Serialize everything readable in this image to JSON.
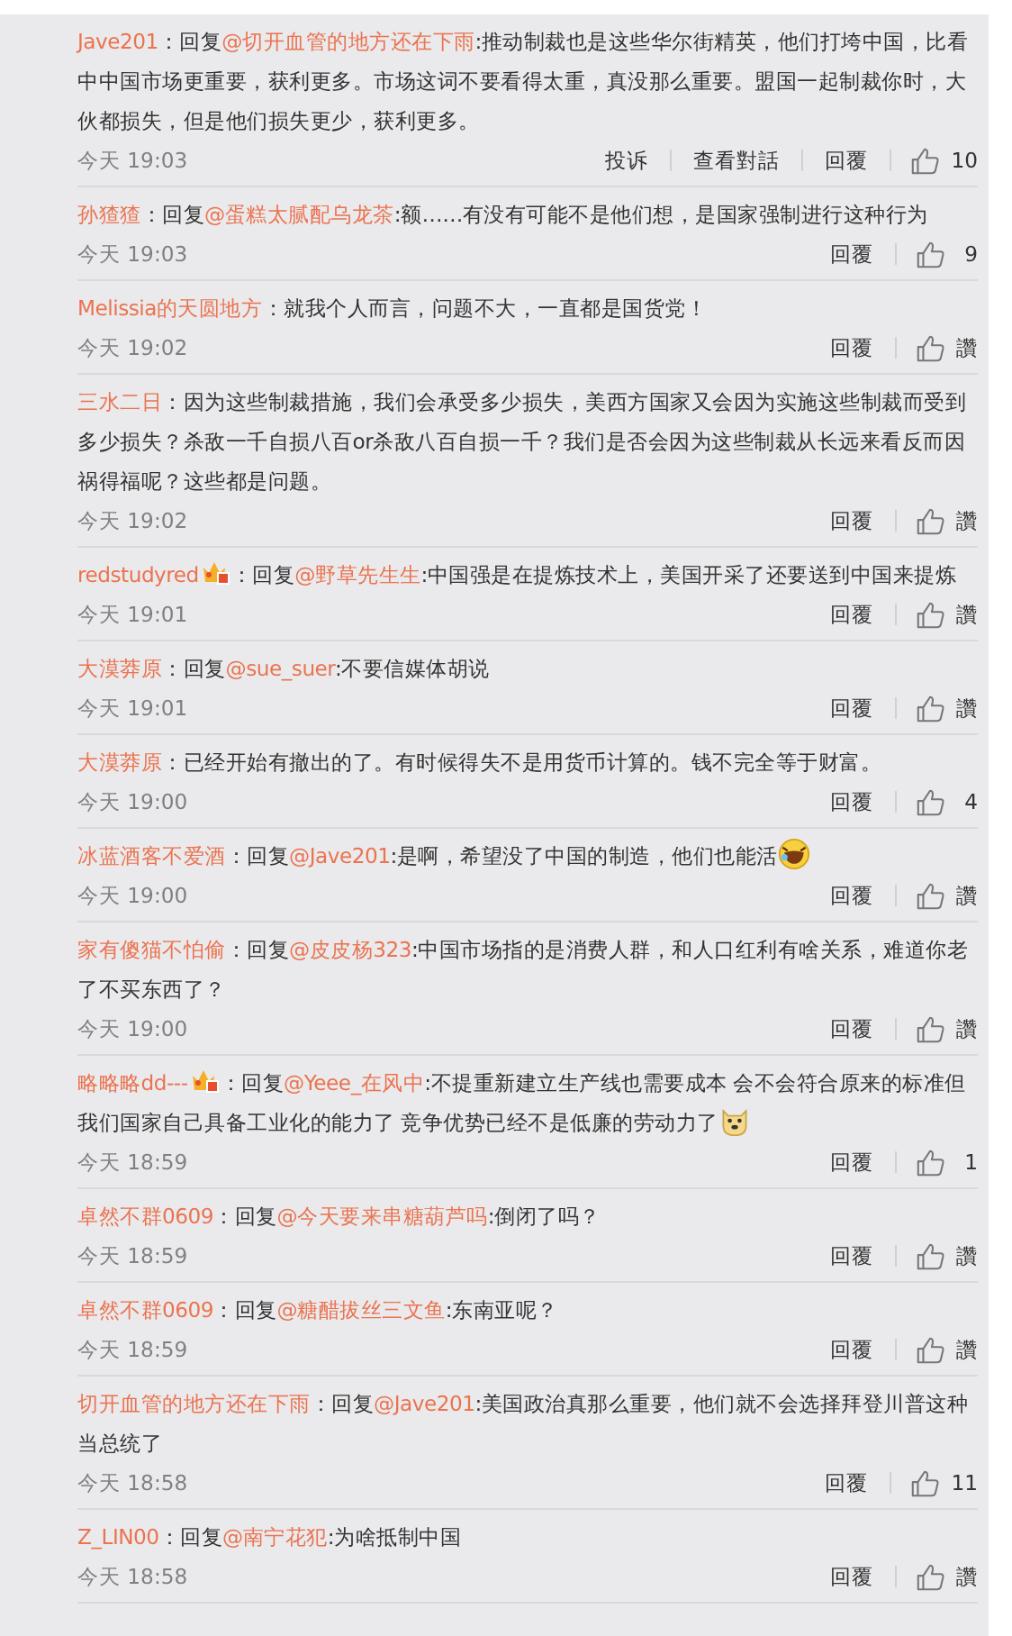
{
  "comments": [
    {
      "user": "Jave201",
      "badge": false,
      "body": [
        {
          "kind": "plain",
          "text": "回复"
        },
        {
          "kind": "mention",
          "text": "@切开血管的地方还在下雨"
        },
        {
          "kind": "plain",
          "text": ":推动制裁也是这些华尔街精英，他们打垮中国，比看中中国市场更重要，获利更多。市场这词不要看得太重，真没那么重要。盟国一起制裁你时，大伙都损失，但是他们损失更少，获利更多。"
        }
      ],
      "time": "今天 19:03",
      "actions": [
        "投诉",
        "查看對話",
        "回覆"
      ],
      "likes": "10"
    },
    {
      "user": "孙猹猹",
      "badge": false,
      "body": [
        {
          "kind": "plain",
          "text": "回复"
        },
        {
          "kind": "mention",
          "text": "@蛋糕太腻配乌龙茶"
        },
        {
          "kind": "plain",
          "text": ":额……有没有可能不是他们想，是国家强制进行这种行为"
        }
      ],
      "time": "今天 19:03",
      "actions": [
        "回覆"
      ],
      "likes": "9"
    },
    {
      "user": "Melissia的天圆地方",
      "badge": false,
      "body": [
        {
          "kind": "plain",
          "text": "就我个人而言，问题不大，一直都是国货党！"
        }
      ],
      "time": "今天 19:02",
      "actions": [
        "回覆"
      ],
      "likes": "讚"
    },
    {
      "user": "三水二日",
      "badge": false,
      "body": [
        {
          "kind": "plain",
          "text": "因为这些制裁措施，我们会承受多少损失，美西方国家又会因为实施这些制裁而受到多少损失？杀敌一千自损八百or杀敌八百自损一千？我们是否会因为这些制裁从长远来看反而因祸得福呢？这些都是问题。"
        }
      ],
      "time": "今天 19:02",
      "actions": [
        "回覆"
      ],
      "likes": "讚"
    },
    {
      "user": "redstudyred",
      "badge": true,
      "body": [
        {
          "kind": "plain",
          "text": "回复"
        },
        {
          "kind": "mention",
          "text": "@野草先生生"
        },
        {
          "kind": "plain",
          "text": ":中国强是在提炼技术上，美国开采了还要送到中国来提炼"
        }
      ],
      "time": "今天 19:01",
      "actions": [
        "回覆"
      ],
      "likes": "讚"
    },
    {
      "user": "大漠莽原",
      "badge": false,
      "body": [
        {
          "kind": "plain",
          "text": "回复"
        },
        {
          "kind": "mention",
          "text": "@sue_suer"
        },
        {
          "kind": "plain",
          "text": ":不要信媒体胡说"
        }
      ],
      "time": "今天 19:01",
      "actions": [
        "回覆"
      ],
      "likes": "讚"
    },
    {
      "user": "大漠莽原",
      "badge": false,
      "body": [
        {
          "kind": "plain",
          "text": "已经开始有撤出的了。有时候得失不是用货币计算的。钱不完全等于财富。"
        }
      ],
      "time": "今天 19:00",
      "actions": [
        "回覆"
      ],
      "likes": "4"
    },
    {
      "user": "冰蓝酒客不爱酒",
      "badge": false,
      "body": [
        {
          "kind": "plain",
          "text": "回复"
        },
        {
          "kind": "mention",
          "text": "@Jave201"
        },
        {
          "kind": "plain",
          "text": ":是啊，希望没了中国的制造，他们也能活"
        }
      ],
      "emoji": {
        "kind": "laugh"
      },
      "time": "今天 19:00",
      "actions": [
        "回覆"
      ],
      "likes": "讚"
    },
    {
      "user": "家有傻猫不怕偷",
      "badge": false,
      "body": [
        {
          "kind": "plain",
          "text": "回复"
        },
        {
          "kind": "mention",
          "text": "@皮皮杨323"
        },
        {
          "kind": "plain",
          "text": ":中国市场指的是消费人群，和人口红利有啥关系，难道你老了不买东西了？"
        }
      ],
      "time": "今天 19:00",
      "actions": [
        "回覆"
      ],
      "likes": "讚"
    },
    {
      "user": "略略略dd---",
      "badge": true,
      "body": [
        {
          "kind": "plain",
          "text": "回复"
        },
        {
          "kind": "mention",
          "text": "@Yeee_在风中"
        },
        {
          "kind": "plain",
          "text": ":不提重新建立生产线也需要成本 会不会符合原来的标准但我们国家自己具备工业化的能力了 竞争优势已经不是低廉的劳动力了"
        }
      ],
      "emoji": {
        "kind": "dog"
      },
      "time": "今天 18:59",
      "actions": [
        "回覆"
      ],
      "likes": "1"
    },
    {
      "user": "卓然不群0609",
      "badge": false,
      "body": [
        {
          "kind": "plain",
          "text": "回复"
        },
        {
          "kind": "mention",
          "text": "@今天要来串糖葫芦吗"
        },
        {
          "kind": "plain",
          "text": ":倒闭了吗？"
        }
      ],
      "time": "今天 18:59",
      "actions": [
        "回覆"
      ],
      "likes": "讚"
    },
    {
      "user": "卓然不群0609",
      "badge": false,
      "body": [
        {
          "kind": "plain",
          "text": "回复"
        },
        {
          "kind": "mention",
          "text": "@糖醋拔丝三文鱼"
        },
        {
          "kind": "plain",
          "text": ":东南亚呢？"
        }
      ],
      "time": "今天 18:59",
      "actions": [
        "回覆"
      ],
      "likes": "讚"
    },
    {
      "user": "切开血管的地方还在下雨",
      "badge": false,
      "body": [
        {
          "kind": "plain",
          "text": "回复"
        },
        {
          "kind": "mention",
          "text": "@Jave201"
        },
        {
          "kind": "plain",
          "text": ":美国政治真那么重要，他们就不会选择拜登川普这种当总统了"
        }
      ],
      "time": "今天 18:58",
      "actions": [
        "回覆"
      ],
      "likes": "11"
    },
    {
      "user": "Z_LIN00",
      "badge": false,
      "body": [
        {
          "kind": "plain",
          "text": "回复"
        },
        {
          "kind": "mention",
          "text": "@南宁花犯"
        },
        {
          "kind": "plain",
          "text": ":为啥抵制中国"
        }
      ],
      "time": "今天 18:58",
      "actions": [
        "回覆"
      ],
      "likes": "讚"
    }
  ],
  "separator": "："
}
